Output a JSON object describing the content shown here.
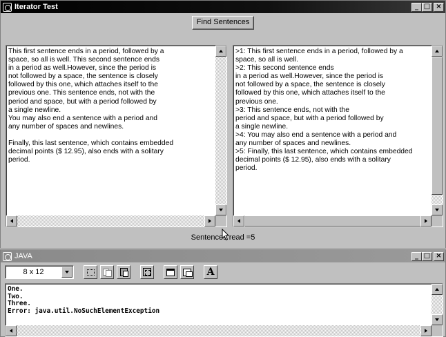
{
  "top_window": {
    "title": "Iterator Test",
    "minimize": "_",
    "maximize": "□",
    "close": "×"
  },
  "find_button": {
    "label": "Find Sentences"
  },
  "left_pane": {
    "lines": [
      "This first sentence ends in a period, followed by a",
      "space, so all is well. This second sentence ends",
      "in a period as well.However, since the period is",
      "not followed by a space, the sentence is closely",
      "followed by this one, which attaches itself to the",
      "previous one. This sentence ends, not with the",
      "period and space, but with a period followed by",
      "a single newline.",
      "You may also end a sentence with a period and",
      "any number of spaces and newlines.",
      "",
      "Finally, this last sentence, which contains embedded",
      "decimal points ($ 12.95), also ends with a solitary",
      "period."
    ]
  },
  "right_pane": {
    "lines": [
      ">1: This first sentence ends in a period, followed by a",
      "space, so all is well.",
      ">2: This second sentence ends",
      "in a period as well.However, since the period is",
      "not followed by a space, the sentence is closely",
      "followed by this one, which attaches itself to the",
      "previous one.",
      ">3: This sentence ends, not with the",
      "period and space, but with a period followed by",
      "a single newline.",
      ">4: You may also end a sentence with a period and",
      "any number of spaces and newlines.",
      ">5: Finally, this last sentence, which contains embedded",
      "decimal points ($ 12.95), also ends with a solitary",
      "period."
    ]
  },
  "status": {
    "text": "Sentences read =5"
  },
  "java_window": {
    "title": "JAVA",
    "minimize": "_",
    "maximize": "□",
    "close": "×",
    "font_size": "8 x 12",
    "font_button": "A"
  },
  "console": {
    "lines": [
      "One.",
      "Two.",
      "Three.",
      "Error: java.util.NoSuchElementException"
    ]
  },
  "icons": {
    "system_menu": "system-menu-icon",
    "mark": "mark-icon",
    "copy": "copy-icon",
    "paste": "paste-icon",
    "fullscreen": "fullscreen-icon",
    "properties": "properties-icon",
    "background": "background-icon",
    "font": "font-icon"
  }
}
